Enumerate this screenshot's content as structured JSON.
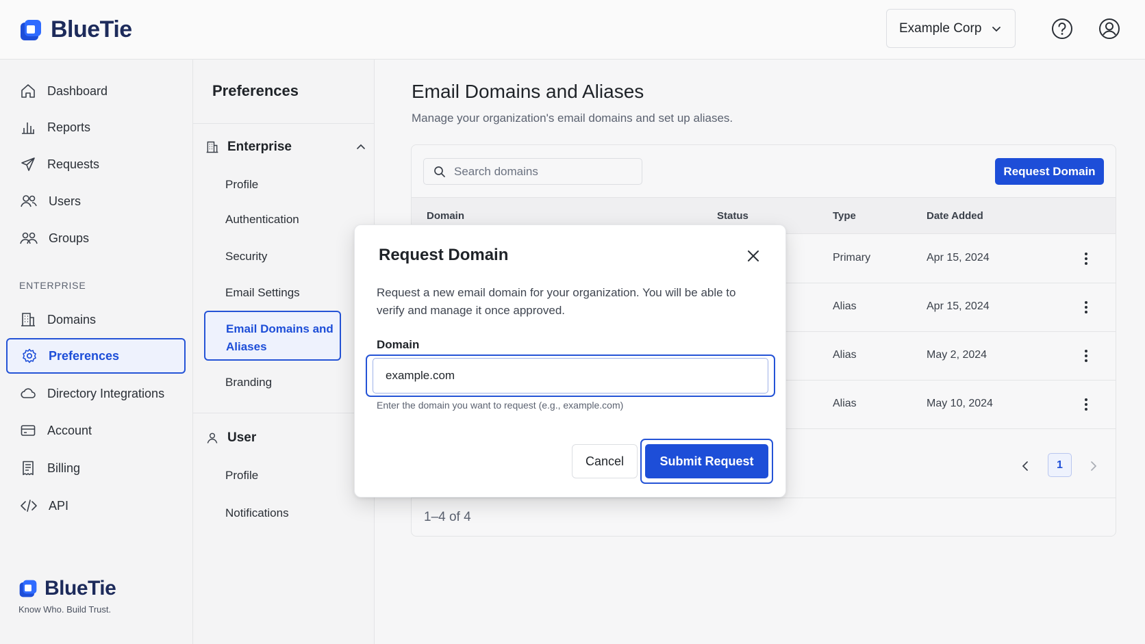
{
  "header": {
    "brand": "BlueTie",
    "org_selector": "Example Corp",
    "icons": [
      "help-icon",
      "account-icon"
    ]
  },
  "sidebar": {
    "items": [
      {
        "label": "Dashboard",
        "icon": "home-icon"
      },
      {
        "label": "Reports",
        "icon": "bar-chart-icon"
      },
      {
        "label": "Requests",
        "icon": "send-icon"
      },
      {
        "label": "Users",
        "icon": "users-icon"
      },
      {
        "label": "Groups",
        "icon": "group-icon"
      }
    ],
    "section_label": "ENTERPRISE",
    "enterprise_items": [
      {
        "label": "Domains",
        "icon": "building-icon"
      },
      {
        "label": "Preferences",
        "icon": "gear-icon",
        "active": true
      },
      {
        "label": "Directory Integrations",
        "icon": "cloud-icon"
      },
      {
        "label": "Account",
        "icon": "card-icon"
      },
      {
        "label": "Billing",
        "icon": "receipt-icon"
      },
      {
        "label": "API",
        "icon": "code-icon"
      }
    ],
    "footer": {
      "brand": "BlueTie",
      "tagline": "Know Who. Build Trust."
    }
  },
  "subnav": {
    "title": "Preferences",
    "enterprise": {
      "label": "Enterprise",
      "items": [
        "Profile",
        "Authentication",
        "Security",
        "Email Settings",
        "Email Domains and Aliases",
        "Branding"
      ],
      "active_item": "Email Domains and Aliases"
    },
    "user": {
      "label": "User",
      "items": [
        "Profile",
        "Notifications"
      ]
    }
  },
  "main": {
    "title": "Email Domains and Aliases",
    "subtitle": "Manage your organization's email domains and set up aliases.",
    "search_placeholder": "Search domains",
    "request_button": "Request Domain",
    "columns": [
      "Domain",
      "Status",
      "Type",
      "Date Added"
    ],
    "rows": [
      {
        "type": "Primary",
        "date": "Apr 15, 2024"
      },
      {
        "type": "Alias",
        "date": "Apr 15, 2024"
      },
      {
        "type": "Alias",
        "date": "May 2, 2024"
      },
      {
        "type": "Alias",
        "date": "May 10, 2024"
      }
    ],
    "pagination": {
      "current_page": "1",
      "count": "1–4 of 4"
    }
  },
  "modal": {
    "title": "Request Domain",
    "description": "Request a new email domain for your organization. You will be able to verify and manage it once approved.",
    "field_label": "Domain",
    "field_value": "example.com",
    "helper_text": "Enter the domain you want to request (e.g., example.com)",
    "cancel_label": "Cancel",
    "submit_label": "Submit Request"
  },
  "colors": {
    "accent": "#1d4ed8",
    "brand_dark": "#1d2b5b",
    "active_bg": "#eef2fd"
  }
}
